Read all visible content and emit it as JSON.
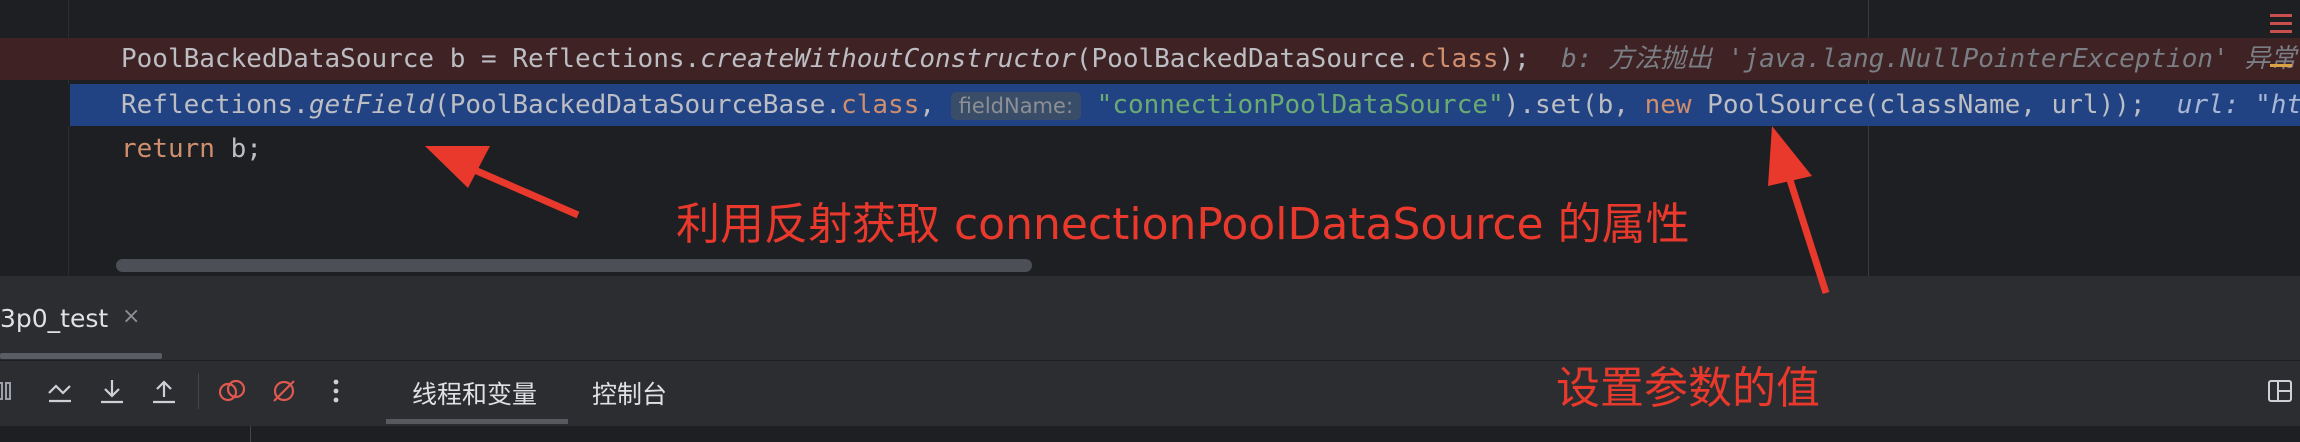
{
  "editor": {
    "line1": {
      "t1": "PoolBackedDataSource b = Reflections.",
      "t2": "createWithoutConstructor",
      "t3": "(PoolBackedDataSource.",
      "t4": "class",
      "t5": ");",
      "note": "b: 方法抛出 'java.lang.NullPointerException' 异常"
    },
    "line2": {
      "t1": "Reflections.",
      "t2": "getField",
      "t3": "(PoolBackedDataSourceBase.",
      "t4": "class",
      "t5": ", ",
      "hint": "fieldName:",
      "t6": "\"connectionPoolDataSource\"",
      "t7": ").set(b, ",
      "t8": "new",
      "t9": " PoolSource(className, url));",
      "note": "url: \"ht"
    },
    "line3": {
      "t1": "return",
      "t2": " b;"
    }
  },
  "tool_window": {
    "tab_title": "3p0_test",
    "tab_close": "×",
    "tabs": [
      "线程和变量",
      "控制台"
    ]
  },
  "annotations": {
    "reflect_note": "利用反射获取 connectionPoolDataSource 的属性",
    "param_note": "设置参数的值"
  },
  "colors": {
    "annotation": "#e8392c",
    "error_line_bg": "#3f2324",
    "selected_line_bg": "#214283"
  }
}
